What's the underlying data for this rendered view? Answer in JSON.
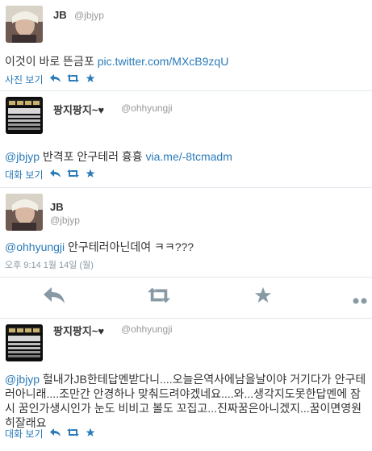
{
  "tweets": [
    {
      "name": "JB",
      "handle": "@jbjyp",
      "text": "이것이 바로 뜬금포 ",
      "link": "pic.twitter.com/MXcB9zqU",
      "action_label": "사진 보기"
    },
    {
      "name": "팡지팡지~♥",
      "handle": "@ohhyungji",
      "mention": "@jbjyp",
      "text": " 반격포 안구테러 흉흉 ",
      "link": "via.me/-8tcmadm",
      "action_label": "대화 보기"
    },
    {
      "name": "JB",
      "handle": "@jbjyp",
      "mention": "@ohhyungji",
      "text": " 안구테러아닌데여 ㅋㅋ???",
      "timestamp": "오후 9:14 1월 14일 (월)"
    },
    {
      "name": "팡지팡지~♥",
      "handle": "@ohhyungji",
      "mention": "@jbjyp",
      "text": " 헐내가JB한테답멘받다니....오늘은역사에남을날이야 거기다가 안구테러아니래....조만간 안경하나 맞춰드려야겠네요....와...생각지도못한답멘에 잠시 꿈인가생시인가 눈도 비비고 볼도 꼬집고...진짜꿈은아니겠지...꿈이면영원히잘래요",
      "action_label": "대화 보기"
    }
  ],
  "icons": {
    "reply": "reply-icon",
    "retweet": "retweet-icon",
    "favorite": "star-icon",
    "more": "more-icon"
  },
  "colors": {
    "link": "#2b7bb9",
    "muted": "#999999",
    "separator": "#e1e8ed",
    "action_grey": "#8899a6"
  }
}
